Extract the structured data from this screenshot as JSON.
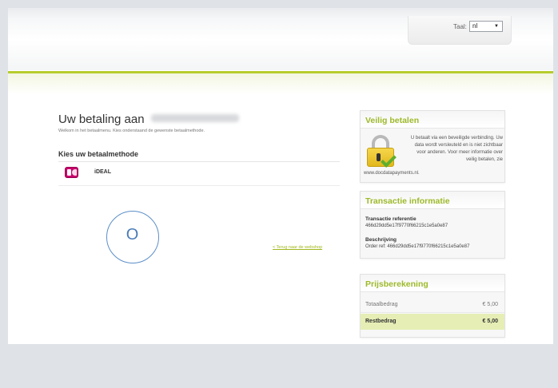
{
  "header": {
    "language_label": "Taal:",
    "language_value": "nl"
  },
  "payment": {
    "title": "Uw betaling aan",
    "welcome": "Welkom in het betaalmenu. Kies onderstaand de gewenste betaalmethode.",
    "choose_heading": "Kies uw betaalmethode",
    "methods": [
      {
        "label": "iDEAL",
        "icon": "ideal-logo-icon"
      }
    ],
    "back_link": "< Terug naar de webshop"
  },
  "overlay": {
    "circle_letter": "O"
  },
  "secure": {
    "title": "Veilig betalen",
    "text": "U betaalt via een beveiligde verbinding. Uw data wordt versleuteld en is niet zichtbaar voor anderen. Voor meer informatie over veilig betalen, zie",
    "link": "www.docdatapayments.nl."
  },
  "transaction": {
    "title": "Transactie informatie",
    "reference_label": "Transactie referentie",
    "reference_value": "466d29dd5e17f9770f66215c1e5a0e87",
    "description_label": "Beschrijving",
    "description_value": "Order ref: 466d29dd5e17f9770f66215c1e5a0e87"
  },
  "pricing": {
    "title": "Prijsberekening",
    "total_label": "Totaalbedrag",
    "total_value": "€ 5,00",
    "rest_label": "Restbedrag",
    "rest_value": "€ 5,00"
  },
  "colors": {
    "accent_green": "#b6cd2c",
    "heading_green": "#9dba2a",
    "highlight_row": "#e6eeb5",
    "circle_blue": "#5c8fc7"
  }
}
